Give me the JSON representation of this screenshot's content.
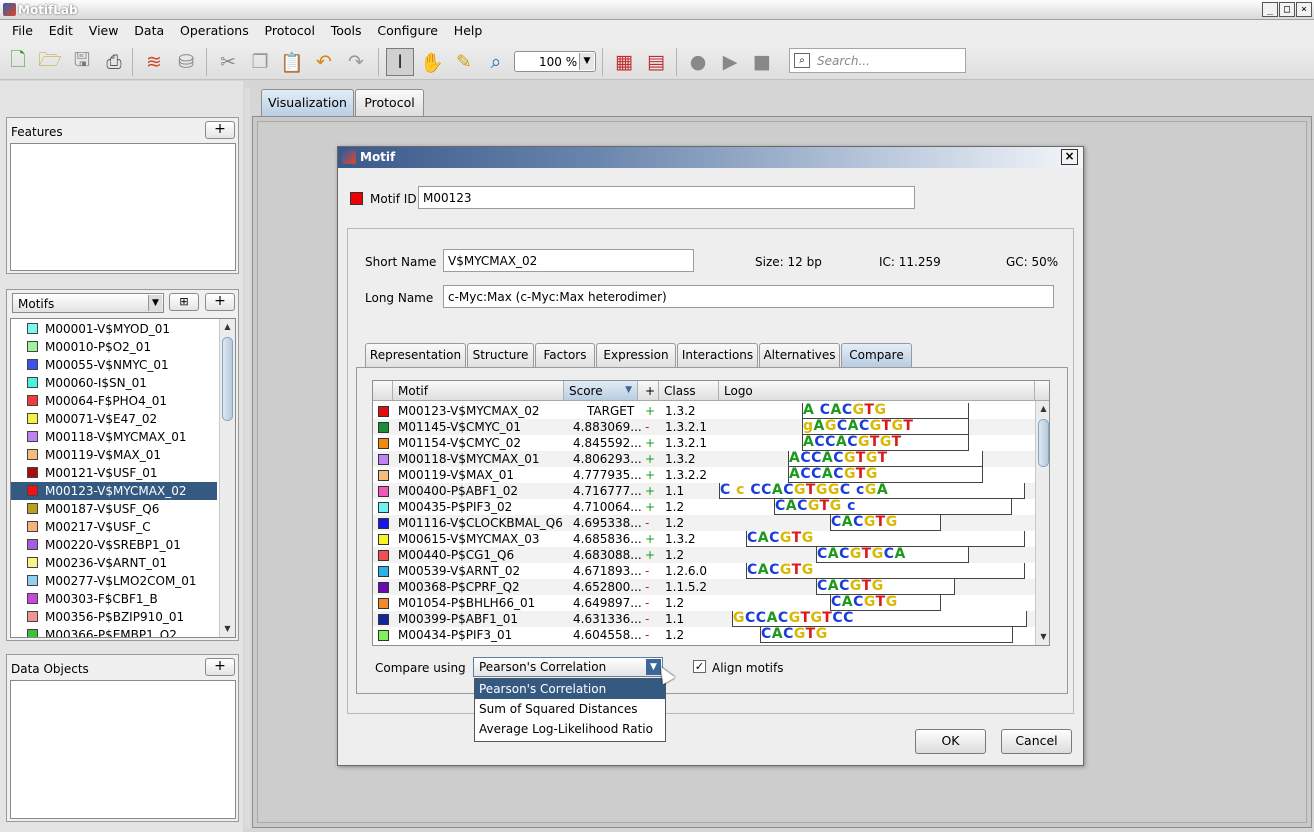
{
  "window": {
    "title": "MotifLab"
  },
  "menu": [
    "File",
    "Edit",
    "View",
    "Data",
    "Operations",
    "Protocol",
    "Tools",
    "Configure",
    "Help"
  ],
  "toolbar": {
    "zoom": "100 %",
    "search_placeholder": "Search..."
  },
  "left": {
    "features_title": "Features",
    "motifs_combo": "Motifs",
    "data_objects_title": "Data Objects",
    "motifs": [
      {
        "name": "M00001-V$MYOD_01",
        "color": "#7ff5ef"
      },
      {
        "name": "M00010-P$O2_01",
        "color": "#9bf49b"
      },
      {
        "name": "M00055-V$NMYC_01",
        "color": "#3a53ea"
      },
      {
        "name": "M00060-I$SN_01",
        "color": "#49f1e0"
      },
      {
        "name": "M00064-F$PHO4_01",
        "color": "#f23b3b"
      },
      {
        "name": "M00071-V$E47_02",
        "color": "#f6f045"
      },
      {
        "name": "M00118-V$MYCMAX_01",
        "color": "#bf82f4"
      },
      {
        "name": "M00119-V$MAX_01",
        "color": "#f7bc7d"
      },
      {
        "name": "M00121-V$USF_01",
        "color": "#a80d0d"
      },
      {
        "name": "M00123-V$MYCMAX_02",
        "color": "#ef1313",
        "selected": true
      },
      {
        "name": "M00187-V$USF_Q6",
        "color": "#b9a021"
      },
      {
        "name": "M00217-V$USF_C",
        "color": "#f7b27a"
      },
      {
        "name": "M00220-V$SREBP1_01",
        "color": "#a15fe2"
      },
      {
        "name": "M00236-V$ARNT_01",
        "color": "#f8f28a"
      },
      {
        "name": "M00277-V$LMO2COM_01",
        "color": "#8fd0f2"
      },
      {
        "name": "M00303-F$CBF1_B",
        "color": "#c54ad8"
      },
      {
        "name": "M00356-P$BZIP910_01",
        "color": "#f29494"
      },
      {
        "name": "M00366-P$EMBP1_Q2",
        "color": "#37c237"
      }
    ]
  },
  "tabs": {
    "visualization": "Visualization",
    "protocol": "Protocol"
  },
  "dialog": {
    "title": "Motif",
    "motif_id_label": "Motif ID",
    "motif_id": "M00123",
    "motif_color": "#ee0000",
    "short_name_label": "Short Name",
    "short_name": "V$MYCMAX_02",
    "long_name_label": "Long Name",
    "long_name": "c-Myc:Max (c-Myc:Max heterodimer)",
    "size": "Size: 12 bp",
    "ic": "IC: 11.259",
    "gc": "GC: 50%",
    "tabs": [
      "Representation",
      "Structure",
      "Factors",
      "Expression",
      "Interactions",
      "Alternatives",
      "Compare"
    ],
    "table": {
      "headers": {
        "motif": "Motif",
        "score": "Score",
        "plus": "+",
        "class": "Class",
        "logo": "Logo"
      },
      "rows": [
        {
          "color": "#e20f0f",
          "motif": "M00123-V$MYCMAX_02",
          "score": "TARGET",
          "strand": "+",
          "cls": "1.3.2"
        },
        {
          "color": "#1a8f3a",
          "motif": "M01145-V$CMYC_01",
          "score": "4.883069...",
          "strand": "-",
          "cls": "1.3.2.1"
        },
        {
          "color": "#f28a10",
          "motif": "M01154-V$CMYC_02",
          "score": "4.845592...",
          "strand": "+",
          "cls": "1.3.2.1"
        },
        {
          "color": "#bf82f4",
          "motif": "M00118-V$MYCMAX_01",
          "score": "4.806293...",
          "strand": "+",
          "cls": "1.3.2"
        },
        {
          "color": "#f7bc7d",
          "motif": "M00119-V$MAX_01",
          "score": "4.777935...",
          "strand": "+",
          "cls": "1.3.2.2"
        },
        {
          "color": "#ef5ab8",
          "motif": "M00400-P$ABF1_02",
          "score": "4.716777...",
          "strand": "+",
          "cls": "1.1"
        },
        {
          "color": "#6ff2f2",
          "motif": "M00435-P$PIF3_02",
          "score": "4.710064...",
          "strand": "+",
          "cls": "1.2"
        },
        {
          "color": "#1616e6",
          "motif": "M01116-V$CLOCKBMAL_Q6",
          "score": "4.695338...",
          "strand": "-",
          "cls": "1.2"
        },
        {
          "color": "#f8f22a",
          "motif": "M00615-V$MYCMAX_03",
          "score": "4.685836...",
          "strand": "+",
          "cls": "1.3.2"
        },
        {
          "color": "#f05050",
          "motif": "M00440-P$CG1_Q6",
          "score": "4.683088...",
          "strand": "+",
          "cls": "1.2"
        },
        {
          "color": "#2ab2ea",
          "motif": "M00539-V$ARNT_02",
          "score": "4.671893...",
          "strand": "-",
          "cls": "1.2.6.0"
        },
        {
          "color": "#6a0ab0",
          "motif": "M00368-P$CPRF_Q2",
          "score": "4.652800...",
          "strand": "-",
          "cls": "1.1.5.2"
        },
        {
          "color": "#f28a2a",
          "motif": "M01054-P$BHLH66_01",
          "score": "4.649897...",
          "strand": "-",
          "cls": "1.2"
        },
        {
          "color": "#12289a",
          "motif": "M00399-P$ABF1_01",
          "score": "4.631336...",
          "strand": "-",
          "cls": "1.1"
        },
        {
          "color": "#7ef25a",
          "motif": "M00434-P$PIF3_01",
          "score": "4.604558...",
          "strand": "-",
          "cls": "1.2"
        }
      ]
    },
    "compare_using_label": "Compare using",
    "compare_using": "Pearson's Correlation",
    "compare_options": [
      "Pearson's Correlation",
      "Sum of Squared Distances",
      "Average Log-Likelihood Ratio"
    ],
    "align_label": "Align motifs",
    "align_checked": "✓",
    "ok": "OK",
    "cancel": "Cancel"
  }
}
